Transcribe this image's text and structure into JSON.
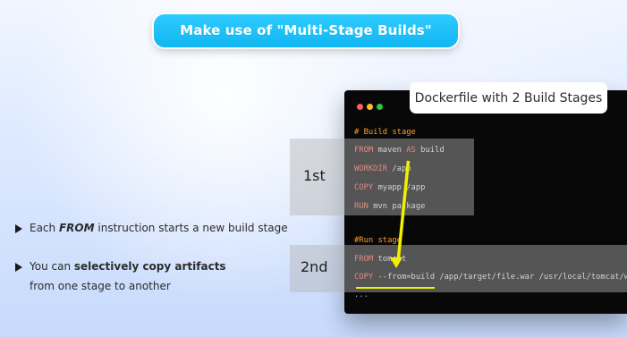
{
  "title": "Make use of \"Multi-Stage Builds\"",
  "callout": "Dockerfile with 2 Build Stages",
  "stage_labels": {
    "first": "1st",
    "second": "2nd"
  },
  "terminal": {
    "lines": {
      "build_stage_comment": "# Build stage",
      "line1_kw1": "FROM",
      "line1_arg1": "maven",
      "line1_kw2": "AS",
      "line1_arg2": "build",
      "line2_kw": "WORKDIR",
      "line2_arg": "/app",
      "line3_kw": "COPY",
      "line3_arg": "myapp /app",
      "line4_kw": "RUN",
      "line4_arg": "mvn package",
      "run_stage_comment": "#Run stage",
      "line5_kw": "FROM",
      "line5_arg": "tomcat",
      "line6_kw": "COPY",
      "line6_flag": "--from=build",
      "line6_arg": "/app/target/file.war /usr/local/tomcat/w",
      "line7": "..."
    }
  },
  "bullets": {
    "first": {
      "prefix": "Each ",
      "keyword": "FROM",
      "suffix": " instruction starts a new build stage"
    },
    "second": {
      "prefix": "You can ",
      "bold": "selectively copy artifacts",
      "sub": "from one stage to another"
    }
  },
  "colors": {
    "title_bg": "#18bdf6",
    "terminal_bg": "#080808",
    "keyword": "#ff6d56",
    "comment": "#ff9e2b",
    "highlight_box": "#b4b4b4",
    "arrow": "#f1f000",
    "red_dot": "#ff5f57",
    "yellow_dot": "#ffbd2e",
    "green_dot": "#28c840"
  },
  "icons": {
    "bullet": "triangle-right-icon",
    "window_dots": [
      "red-dot-icon",
      "yellow-dot-icon",
      "green-dot-icon"
    ]
  }
}
